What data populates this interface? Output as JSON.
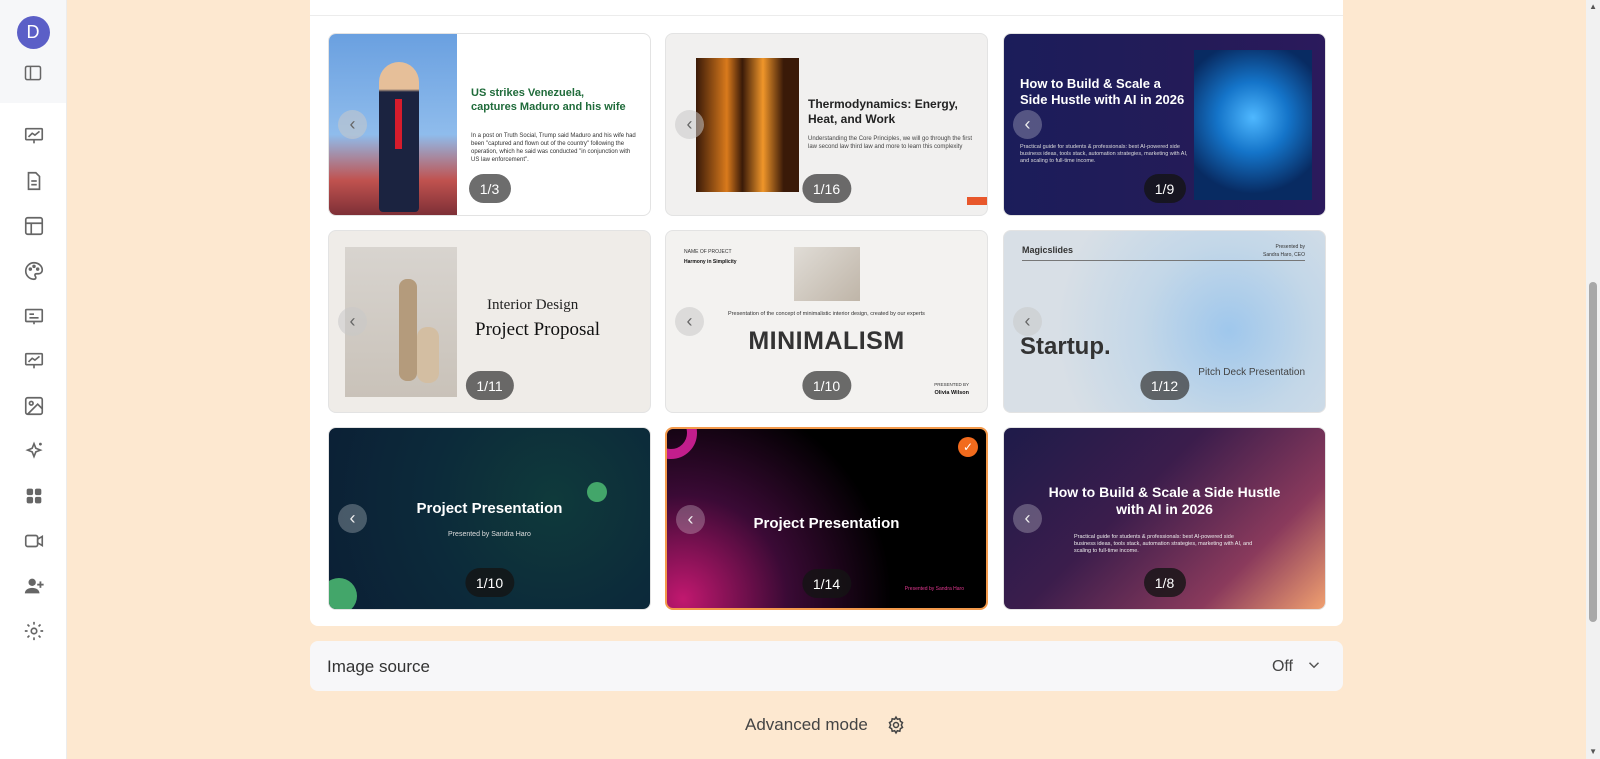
{
  "sidebar": {
    "avatar_letter": "D",
    "icons": [
      "presentation-icon",
      "document-icon",
      "layout-icon",
      "palette-icon",
      "slides-icon",
      "chart-presentation-icon",
      "image-icon",
      "sparkle-icon",
      "apps-icon",
      "video-icon",
      "add-user-icon",
      "settings-icon"
    ]
  },
  "templates": [
    {
      "counter": "1/3",
      "title": "US strikes Venezuela, captures Maduro and his wife",
      "body": "In a post on Truth Social, Trump said Maduro and his wife had been \"captured and flown out of the country\" following the operation, which he said was conducted \"in conjunction with US law enforcement\"."
    },
    {
      "counter": "1/16",
      "title": "Thermodynamics: Energy, Heat, and Work",
      "body": "Understanding the Core Principles, we will go through the first law second law third law and more to learn this complexity"
    },
    {
      "counter": "1/9",
      "title": "How to Build & Scale a Side Hustle with AI in 2026",
      "body": "Practical guide for students & professionals: best AI-powered side business ideas, tools stack, automation strategies, marketing with AI, and scaling to full-time income."
    },
    {
      "counter": "1/11",
      "line1": "Interior Design",
      "line2": "Project Proposal"
    },
    {
      "counter": "1/10",
      "kicker": "NAME OF PROJECT",
      "project": "Harmony in Simplicity",
      "desc": "Presentation of the concept of minimalistic interior design, created by our experts",
      "main": "MINIMALISM",
      "presented_by": "PRESENTED BY",
      "name": "Olivia Wilson"
    },
    {
      "counter": "1/12",
      "logo": "Magicslides",
      "presented": "Presented by",
      "ceo": "Sandra Haro, CEO",
      "main": "Startup.",
      "sub": "Pitch Deck Presentation"
    },
    {
      "counter": "1/10",
      "title": "Project Presentation",
      "sub": "Presented by Sandra Haro"
    },
    {
      "counter": "1/14",
      "title": "Project Presentation",
      "foot": "Presented by Sandra Haro",
      "selected_mark": "✓"
    },
    {
      "counter": "1/8",
      "title": "How to Build & Scale a Side Hustle with AI in 2026",
      "body": "Practical guide for students & professionals: best AI-powered side business ideas, tools stack, automation strategies, marketing with AI, and scaling to full-time income."
    }
  ],
  "prev_glyph": "‹",
  "image_source": {
    "label": "Image source",
    "value": "Off"
  },
  "advanced_mode": {
    "label": "Advanced mode"
  },
  "scroll": {
    "up": "▲",
    "down": "▼"
  }
}
